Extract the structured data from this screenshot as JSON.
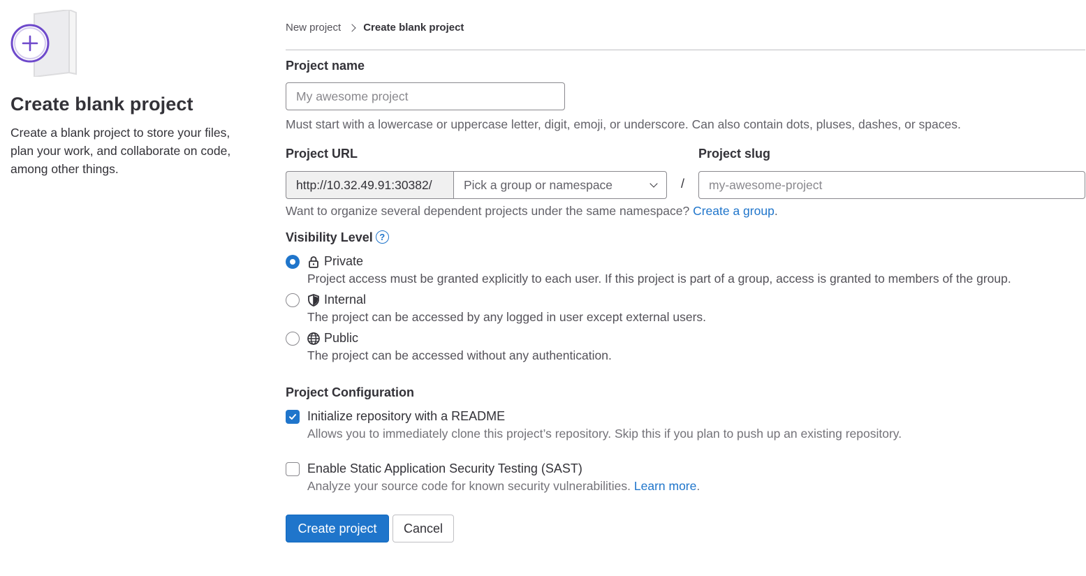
{
  "intro": {
    "title": "Create blank project",
    "description": "Create a blank project to store your files, plan your work, and collaborate on code, among other things."
  },
  "breadcrumb": {
    "parent": "New project",
    "current": "Create blank project"
  },
  "project_name": {
    "label": "Project name",
    "placeholder": "My awesome project",
    "value": "",
    "help": "Must start with a lowercase or uppercase letter, digit, emoji, or underscore. Can also contain dots, pluses, dashes, or spaces."
  },
  "project_url": {
    "label": "Project URL",
    "prefix": "http://10.32.49.91:30382/",
    "namespace_placeholder": "Pick a group or namespace",
    "separator": "/",
    "help_text": "Want to organize several dependent projects under the same namespace?",
    "help_link": "Create a group",
    "help_suffix": "."
  },
  "project_slug": {
    "label": "Project slug",
    "placeholder": "my-awesome-project",
    "value": ""
  },
  "visibility": {
    "label": "Visibility Level",
    "help_icon": "question-circle-icon",
    "selected": "private",
    "options": [
      {
        "key": "private",
        "icon": "lock-icon",
        "label": "Private",
        "help": "Project access must be granted explicitly to each user. If this project is part of a group, access is granted to members of the group."
      },
      {
        "key": "internal",
        "icon": "shield-icon",
        "label": "Internal",
        "help": "The project can be accessed by any logged in user except external users."
      },
      {
        "key": "public",
        "icon": "globe-icon",
        "label": "Public",
        "help": "The project can be accessed without any authentication."
      }
    ]
  },
  "configuration": {
    "label": "Project Configuration",
    "readme": {
      "checked": true,
      "label": "Initialize repository with a README",
      "help": "Allows you to immediately clone this project’s repository. Skip this if you plan to push up an existing repository."
    },
    "sast": {
      "checked": false,
      "label": "Enable Static Application Security Testing (SAST)",
      "help_text": "Analyze your source code for known security vulnerabilities.",
      "help_link": "Learn more",
      "help_suffix": "."
    }
  },
  "actions": {
    "create": "Create project",
    "cancel": "Cancel"
  },
  "colors": {
    "primary": "#1f75cb",
    "illustration_purple": "#6e49cb",
    "text": "#333238",
    "muted": "#626168"
  }
}
